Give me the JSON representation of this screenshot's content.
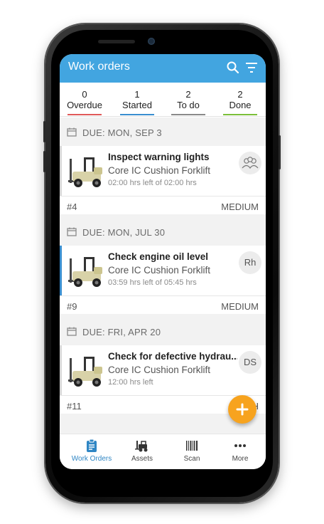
{
  "header": {
    "title": "Work orders",
    "search_icon": "search-icon",
    "filter_icon": "filter-icon",
    "color": "#42a5e0"
  },
  "tabs": [
    {
      "count": "0",
      "label": "Overdue",
      "color": "#e05a5a"
    },
    {
      "count": "1",
      "label": "Started",
      "color": "#3a8fd0"
    },
    {
      "count": "2",
      "label": "To do",
      "color": "#8a8a8a"
    },
    {
      "count": "2",
      "label": "Done",
      "color": "#7cbf3a"
    }
  ],
  "work_orders": [
    {
      "due": "DUE: MON, SEP 3",
      "title": "Inspect warning lights",
      "asset": "Core IC Cushion Forklift",
      "time": "02:00 hrs left of 02:00 hrs",
      "assignee": "",
      "assignee_icon": "team-icon",
      "number": "#4",
      "priority": "MEDIUM"
    },
    {
      "due": "DUE: MON, JUL 30",
      "title": "Check engine oil level",
      "asset": "Core IC Cushion Forklift",
      "time": "03:59 hrs left of 05:45 hrs",
      "assignee": "Rh",
      "number": "#9",
      "priority": "MEDIUM",
      "accent": "#3a8fd0"
    },
    {
      "due": "DUE: FRI, APR 20",
      "title": "Check for defective hydrau...",
      "asset": "Core IC Cushion Forklift",
      "time": "12:00 hrs left",
      "assignee": "DS",
      "number": "#11",
      "priority": "H"
    }
  ],
  "fab": {
    "icon": "plus-icon",
    "color": "#f7a31e"
  },
  "bottom_nav": [
    {
      "label": "Work Orders",
      "icon": "clipboard-icon",
      "active": true
    },
    {
      "label": "Assets",
      "icon": "forklift-icon"
    },
    {
      "label": "Scan",
      "icon": "barcode-icon"
    },
    {
      "label": "More",
      "icon": "more-icon"
    }
  ]
}
